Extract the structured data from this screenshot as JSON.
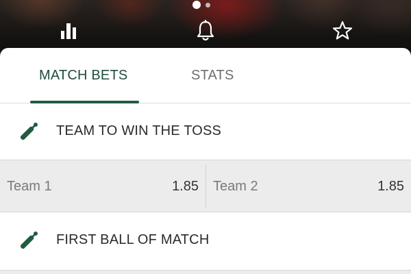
{
  "header": {
    "carousel": {
      "pages": 2,
      "active_page": 1
    },
    "icons": [
      "bar-chart-icon",
      "bell-icon",
      "star-icon"
    ]
  },
  "tabs": [
    {
      "label": "MATCH BETS",
      "active": true
    },
    {
      "label": "STATS",
      "active": false
    }
  ],
  "markets": [
    {
      "title": "TEAM TO WIN THE TOSS",
      "icon": "cricket-bat-icon",
      "selections": [
        {
          "team": "Team 1",
          "odds": "1.85"
        },
        {
          "team": "Team 2",
          "odds": "1.85"
        }
      ]
    },
    {
      "title": "FIRST BALL OF MATCH",
      "icon": "cricket-bat-icon"
    }
  ],
  "colors": {
    "accent": "#1f5c40",
    "active_tab_text": "#1f4d3a",
    "inactive_tab_text": "#6e6e6e",
    "odds_row_background": "#ececec"
  }
}
